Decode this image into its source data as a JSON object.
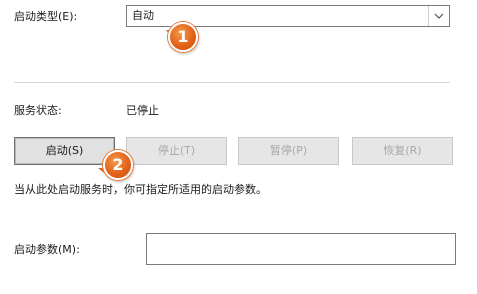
{
  "startup_type": {
    "label": "启动类型(E):",
    "value": "自动"
  },
  "service_status": {
    "label": "服务状态:",
    "value": "已停止"
  },
  "buttons": {
    "start": "启动(S)",
    "stop": "停止(T)",
    "pause": "暂停(P)",
    "resume": "恢复(R)"
  },
  "hint": "当从此处启动服务时，你可指定所适用的启动参数。",
  "startup_params": {
    "label": "启动参数(M):",
    "value": ""
  },
  "annotations": {
    "step1": "1",
    "step2": "2"
  },
  "colors": {
    "badge": "#e2631a",
    "button_bg": "#e1e1e1",
    "disabled_text": "#a8a8a8"
  }
}
